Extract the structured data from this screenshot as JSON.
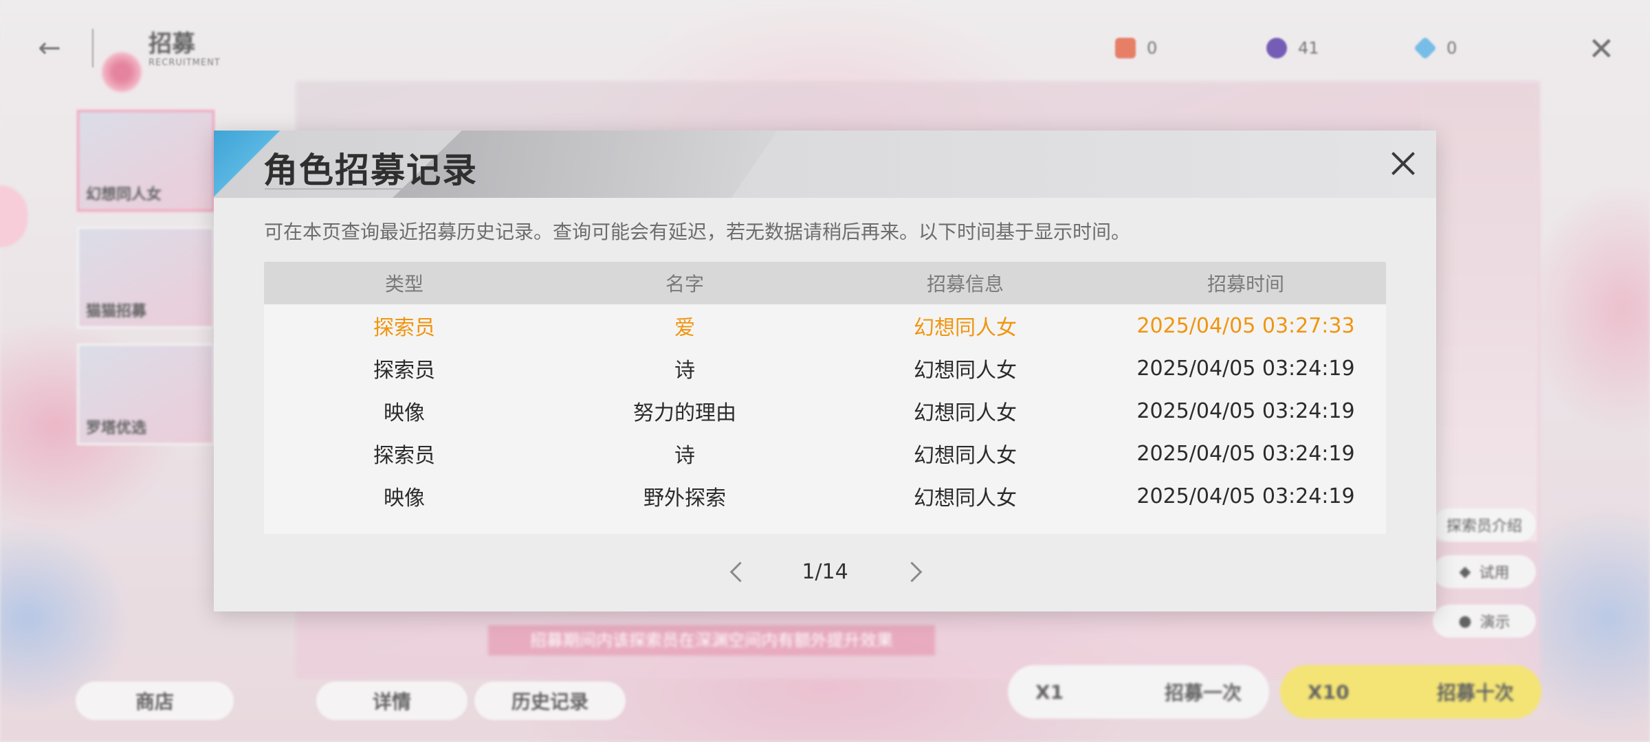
{
  "topbar": {
    "title": "招募",
    "subtitle": "RECRUITMENT",
    "currencies": [
      {
        "icon": "ticket-icon",
        "value": "0",
        "color": "#e5735a"
      },
      {
        "icon": "crystal-orb-icon",
        "value": "41",
        "color": "#6a4fb0"
      },
      {
        "icon": "diamond-icon",
        "value": "0",
        "color": "#6cb8e6"
      }
    ]
  },
  "sidebar": {
    "banners": [
      {
        "label": "幻想同人女"
      },
      {
        "label": "猫猫招募"
      },
      {
        "label": "罗塔优选"
      }
    ]
  },
  "right_panel": {
    "caption": "探索员介绍",
    "try_label": "试用",
    "demo_label": "演示"
  },
  "promo_text": "招募期间内该探索员在深渊空间内有额外提升效果",
  "bottom": {
    "shop_label": "商店",
    "details_label": "详情",
    "history_label": "历史记录",
    "recruit_once": {
      "count": "X1",
      "label": "招募一次"
    },
    "recruit_ten": {
      "count": "X10",
      "label": "招募十次"
    }
  },
  "modal": {
    "title": "角色招募记录",
    "note": "可在本页查询最近招募历史记录。查询可能会有延迟，若无数据请稍后再来。以下时间基于显示时间。",
    "columns": [
      "类型",
      "名字",
      "招募信息",
      "招募时间"
    ],
    "rows": [
      {
        "type": "探索员",
        "name": "爱",
        "info": "幻想同人女",
        "time": "2025/04/05 03:27:33",
        "highlight": true
      },
      {
        "type": "探索员",
        "name": "诗",
        "info": "幻想同人女",
        "time": "2025/04/05 03:24:19",
        "highlight": false
      },
      {
        "type": "映像",
        "name": "努力的理由",
        "info": "幻想同人女",
        "time": "2025/04/05 03:24:19",
        "highlight": false
      },
      {
        "type": "探索员",
        "name": "诗",
        "info": "幻想同人女",
        "time": "2025/04/05 03:24:19",
        "highlight": false
      },
      {
        "type": "映像",
        "name": "野外探索",
        "info": "幻想同人女",
        "time": "2025/04/05 03:24:19",
        "highlight": false
      }
    ],
    "pager": {
      "label": "1/14"
    },
    "highlight_color": "#f0950f"
  }
}
